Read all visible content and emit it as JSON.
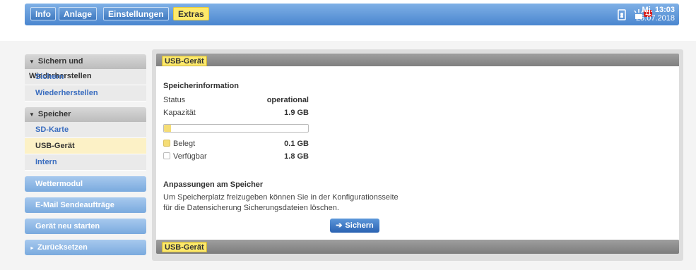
{
  "nav": {
    "tabs": [
      {
        "label": "Info"
      },
      {
        "label": "Anlage"
      },
      {
        "label": "Einstellungen"
      },
      {
        "label": "Extras"
      }
    ],
    "notification_count": "11",
    "time": "Mi. 13:03",
    "date": "25.07.2018"
  },
  "sidebar": {
    "group1": {
      "title": "Sichern und Wiederherstellen",
      "items": [
        {
          "label": "Sichern"
        },
        {
          "label": "Wiederherstellen"
        }
      ]
    },
    "group2": {
      "title": "Speicher",
      "items": [
        {
          "label": "SD-Karte"
        },
        {
          "label": "USB-Gerät"
        },
        {
          "label": "Intern"
        }
      ]
    },
    "buttons": [
      {
        "label": "Wettermodul"
      },
      {
        "label": "E-Mail Sendeaufträge"
      },
      {
        "label": "Gerät neu starten"
      },
      {
        "label": "Zurücksetzen"
      }
    ]
  },
  "content": {
    "tab_label": "USB-Gerät",
    "footer_tab_label": "USB-Gerät",
    "storage": {
      "heading": "Speicherinformation",
      "status_label": "Status",
      "status_value": "operational",
      "capacity_label": "Kapazität",
      "capacity_value": "1.9 GB",
      "used_fraction": 0.05,
      "used_label": "Belegt",
      "used_value": "0.1 GB",
      "free_label": "Verfügbar",
      "free_value": "1.8 GB"
    },
    "adjust": {
      "heading": "Anpassungen am Speicher",
      "line1": "Um Speicherplatz freizugeben können Sie in der Konfigurationsseite",
      "line2": "für die Datensicherung Sicherungsdateien löschen.",
      "button_label": "Sichern"
    }
  },
  "colors": {
    "accent_yellow": "#fde96a",
    "nav_blue": "#4a86cf",
    "link_blue": "#3a6dbf"
  }
}
